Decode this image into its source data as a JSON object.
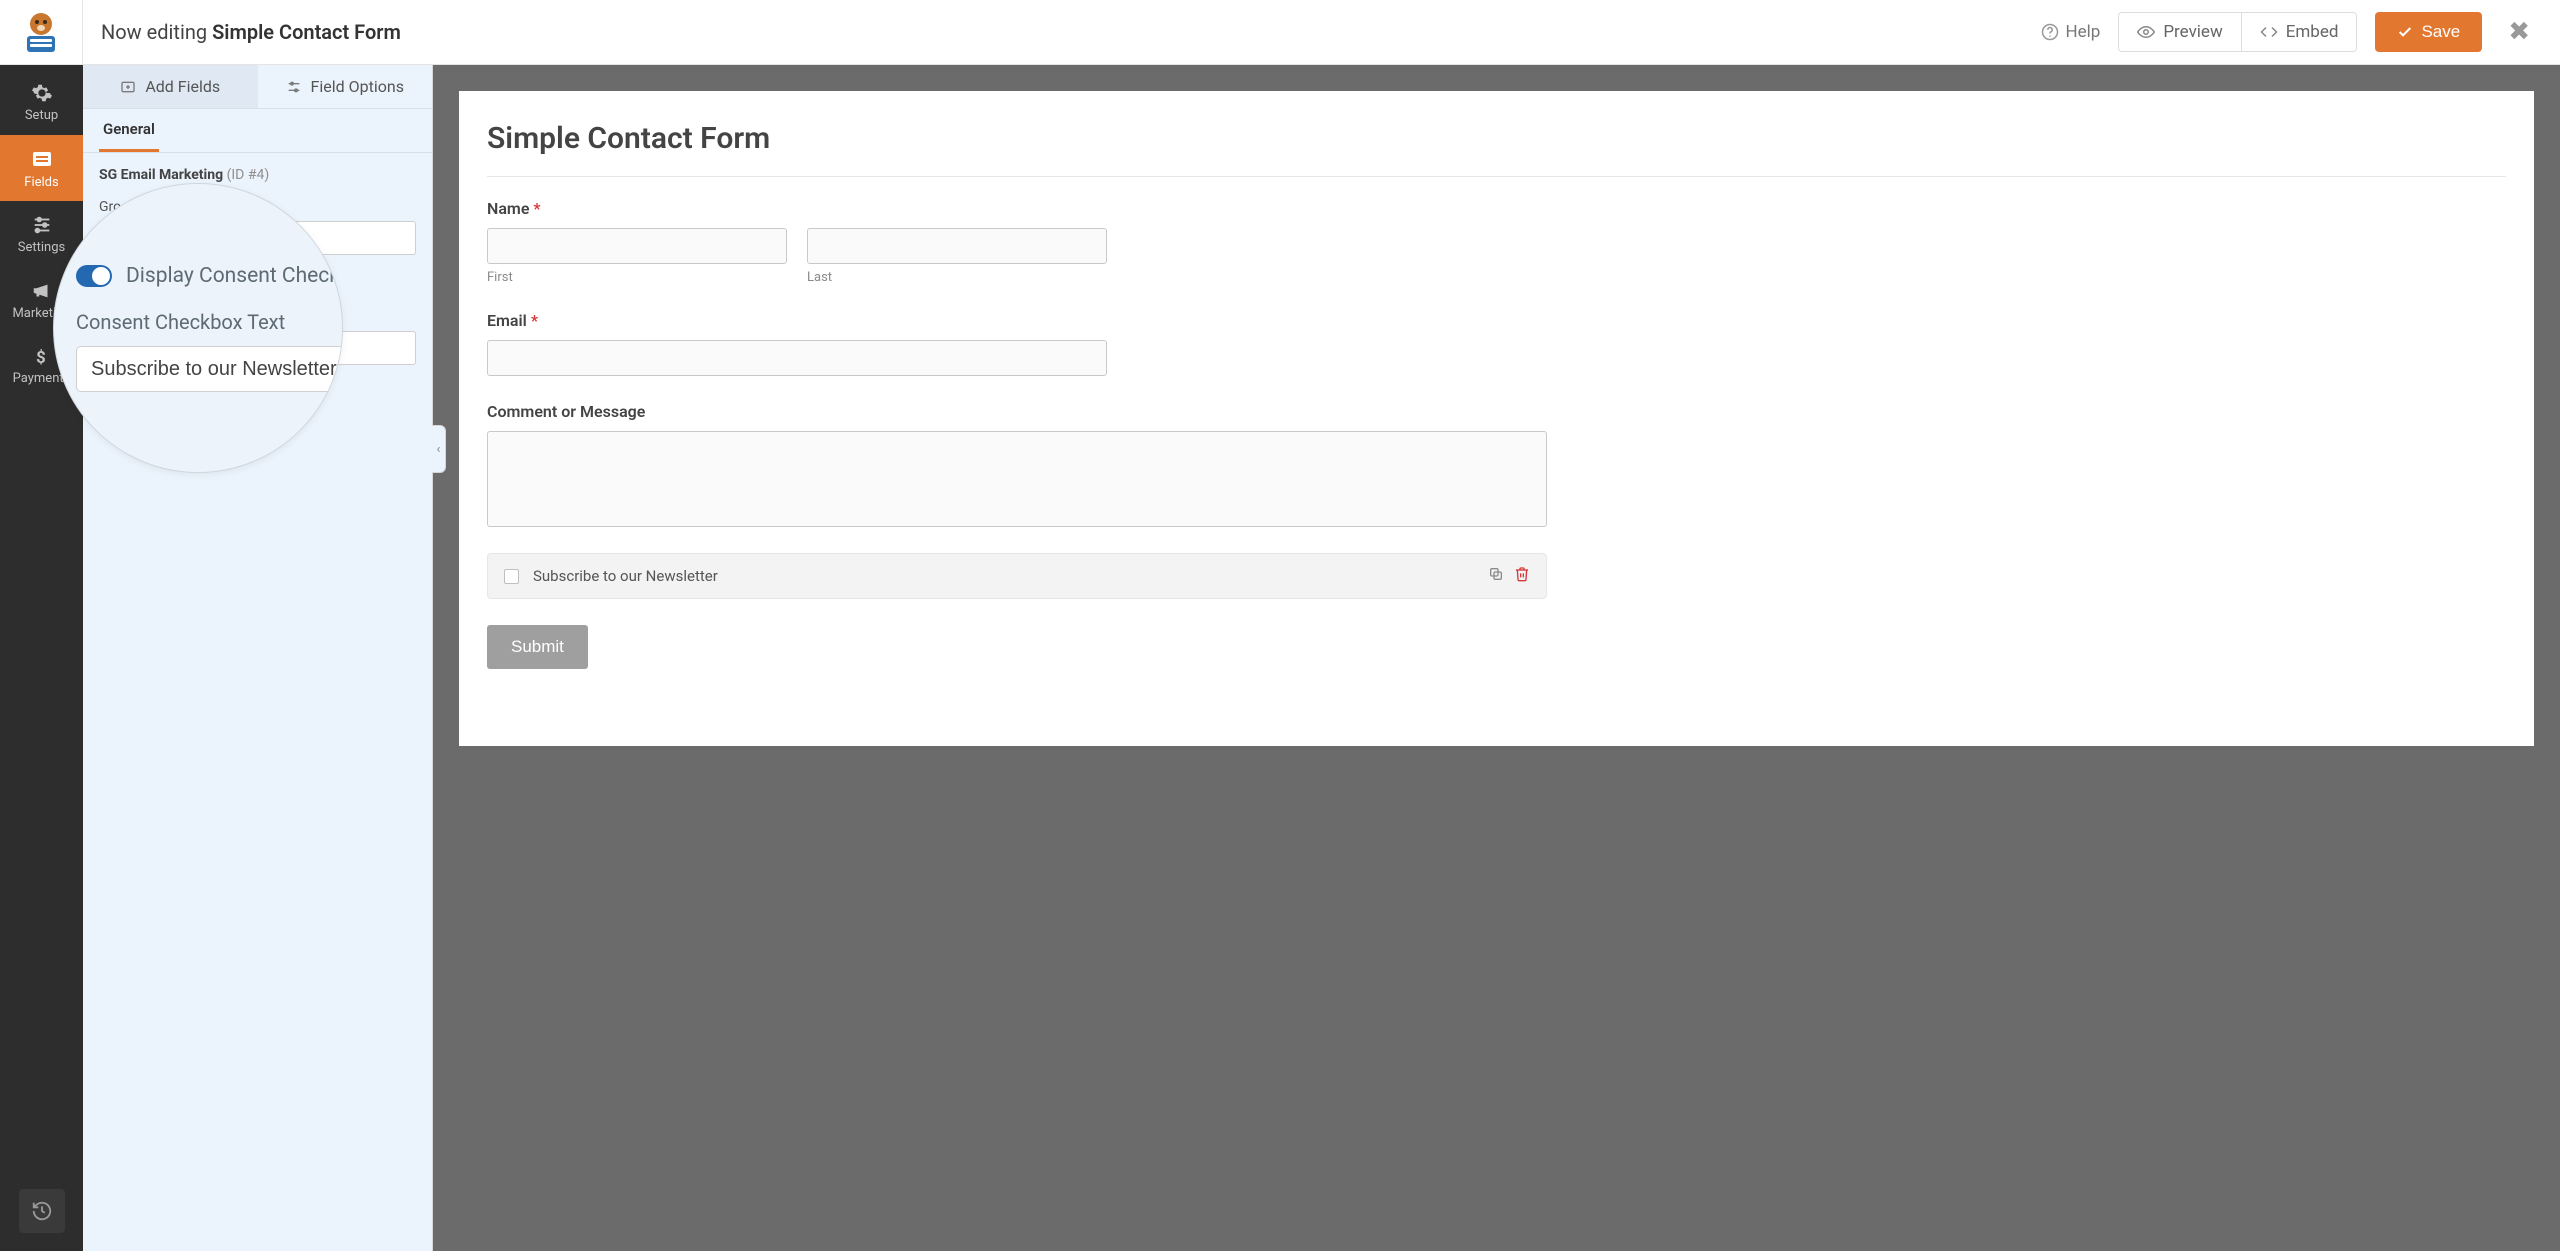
{
  "header": {
    "prefix": "Now editing",
    "title": "Simple Contact Form",
    "help": "Help",
    "preview": "Preview",
    "embed": "Embed",
    "save": "Save"
  },
  "sidenav": {
    "items": [
      {
        "label": "Setup"
      },
      {
        "label": "Fields"
      },
      {
        "label": "Settings"
      },
      {
        "label": "Marketing"
      },
      {
        "label": "Payments"
      }
    ]
  },
  "panel": {
    "tabs": {
      "add_fields": "Add Fields",
      "field_options": "Field Options"
    },
    "subtab_general": "General",
    "field_name": "SG Email Marketing",
    "field_id": "(ID #4)",
    "group_label_partial": "Gro",
    "group_value": "",
    "consent_value": ""
  },
  "zoom": {
    "toggle_label": "Display Consent Check",
    "text_label": "Consent Checkbox Text",
    "text_value": "Subscribe to our Newsletter"
  },
  "form": {
    "title": "Simple Contact Form",
    "name_label": "Name",
    "first_sublabel": "First",
    "last_sublabel": "Last",
    "email_label": "Email",
    "message_label": "Comment or Message",
    "consent_text": "Subscribe to our Newsletter",
    "submit": "Submit"
  }
}
